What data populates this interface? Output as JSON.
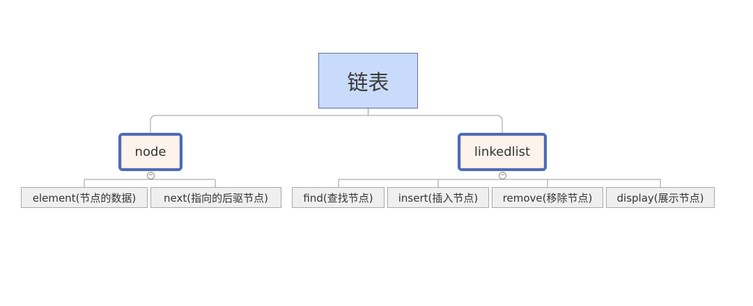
{
  "diagram": {
    "type": "mind-map",
    "root": {
      "label": "链表"
    },
    "branches": [
      {
        "id": "node",
        "label": "node",
        "children": [
          {
            "id": "element",
            "label": "element(节点的数据)"
          },
          {
            "id": "next",
            "label": "next(指向的后驱节点)"
          }
        ]
      },
      {
        "id": "linkedlist",
        "label": "linkedlist",
        "children": [
          {
            "id": "find",
            "label": "find(查找节点)"
          },
          {
            "id": "insert",
            "label": "insert(插入节点)"
          },
          {
            "id": "remove",
            "label": "remove(移除节点)"
          },
          {
            "id": "display",
            "label": "display(展示节点)"
          }
        ]
      }
    ],
    "collapse_symbol": "−"
  },
  "colors": {
    "root_fill": "#c9dbfb",
    "root_border": "#5a6f9e",
    "branch_fill": "#fdf3ec",
    "branch_border": "#4a6cba",
    "leaf_fill": "#efefef",
    "leaf_border": "#a7a7a7",
    "connector": "#9a9a9a"
  }
}
